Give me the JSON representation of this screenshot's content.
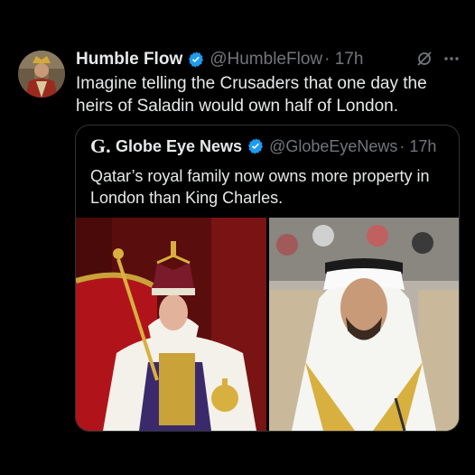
{
  "tweet": {
    "author": "Humble Flow",
    "handle": "@HumbleFlow",
    "time": "· 17h",
    "text": "Imagine telling the Crusaders that one day the heirs of Saladin would own half of London.",
    "icons": [
      "verified-badge-icon",
      "grok-icon",
      "more-icon"
    ]
  },
  "quoted": {
    "logo": "G.",
    "author": "Globe Eye News",
    "handle": "@GlobeEyeNews",
    "time": "· 17h",
    "text": "Qatar’s royal family now owns more property in London than King Charles.",
    "images": [
      "king-charles-photo",
      "emir-qatar-photo"
    ]
  },
  "colors": {
    "background": "#000000",
    "muted": "#71767b",
    "verified": "#1d9bf0",
    "border": "#2f3336"
  }
}
